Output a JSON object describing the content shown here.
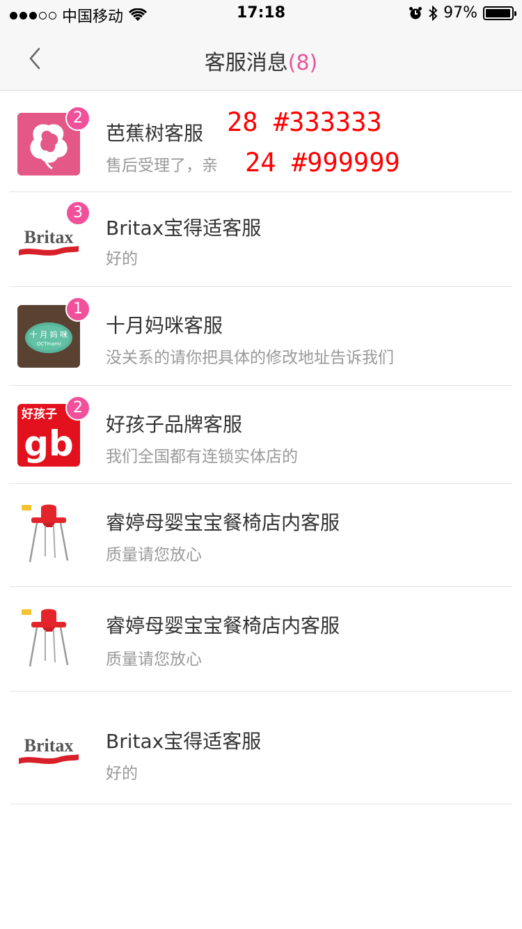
{
  "status": {
    "carrier": "中国移动",
    "time": "17:18",
    "battery": "97%",
    "battery_level": 0.97
  },
  "nav": {
    "title": "客服消息",
    "count": "(8)"
  },
  "annotations": {
    "title_spec": "28 #333333",
    "preview_spec": "24 #999999"
  },
  "conversations": [
    {
      "name": "芭蕉树客服",
      "preview": "售后受理了，亲",
      "badge": "2",
      "avatar": "banana-tree-logo"
    },
    {
      "name": "Britax宝得适客服",
      "preview": "好的",
      "badge": "3",
      "avatar": "britax-logo",
      "logo_text": "Britax"
    },
    {
      "name": "十月妈咪客服",
      "preview": "没关系的请你把具体的修改地址告诉我们",
      "badge": "1",
      "avatar": "oct-mami-logo",
      "logo_text": "十 月 妈 咪",
      "logo_sub": "OCTmami"
    },
    {
      "name": "好孩子品牌客服",
      "preview": "我们全国都有连锁实体店的",
      "badge": "2",
      "avatar": "goodbaby-logo",
      "logo_text": "好孩子",
      "logo_sub": "gb"
    },
    {
      "name": "睿婷母婴宝宝餐椅店内客服",
      "preview": "质量请您放心",
      "badge": "",
      "avatar": "high-chair-image"
    },
    {
      "name": "睿婷母婴宝宝餐椅店内客服",
      "preview": "质量请您放心",
      "badge": "",
      "avatar": "high-chair-image"
    },
    {
      "name": "Britax宝得适客服",
      "preview": "好的",
      "badge": "",
      "avatar": "britax-logo",
      "logo_text": "Britax"
    }
  ]
}
